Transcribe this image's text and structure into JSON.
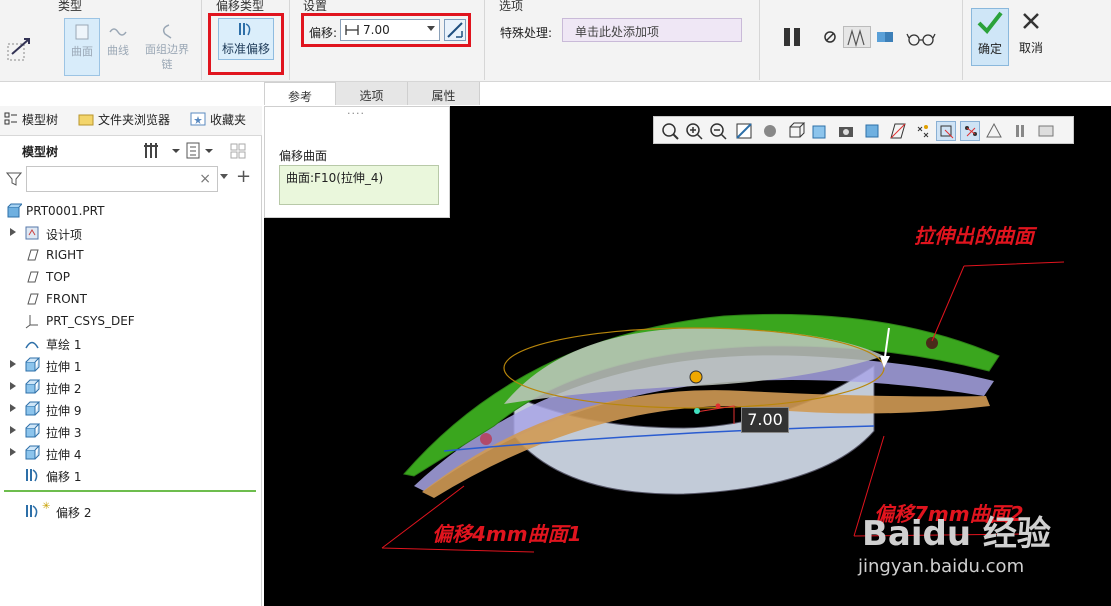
{
  "ribbon": {
    "type_group_title": "类型",
    "type_buttons": [
      {
        "label": "曲面",
        "icon": "surface-icon"
      },
      {
        "label": "曲线",
        "icon": "curve-icon"
      },
      {
        "label": "面组边界链",
        "icon": "quilt-edge-chain-icon"
      }
    ],
    "offset_type_title": "偏移类型",
    "standard_offset_label": "标准偏移",
    "settings_title": "设置",
    "offset_label": "偏移:",
    "offset_value": "7.00",
    "options_title": "选项",
    "special_label": "特殊处理:",
    "special_placeholder": "单击此处添加项",
    "ok_label": "确定",
    "cancel_label": "取消"
  },
  "subtabs": [
    "参考",
    "选项",
    "属性"
  ],
  "left_tabs": [
    "模型树",
    "文件夹浏览器",
    "收藏夹"
  ],
  "tree": {
    "header": "模型树",
    "root": "PRT0001.PRT",
    "items": [
      {
        "label": "设计项",
        "icon": "design-item-icon",
        "expand": true
      },
      {
        "label": "RIGHT",
        "icon": "datum-plane-icon",
        "expand": false
      },
      {
        "label": "TOP",
        "icon": "datum-plane-icon",
        "expand": false
      },
      {
        "label": "FRONT",
        "icon": "datum-plane-icon",
        "expand": false
      },
      {
        "label": "PRT_CSYS_DEF",
        "icon": "csys-icon",
        "expand": false
      },
      {
        "label": "草绘 1",
        "icon": "sketch-icon",
        "expand": false
      },
      {
        "label": "拉伸 1",
        "icon": "extrude-icon",
        "expand": true
      },
      {
        "label": "拉伸 2",
        "icon": "extrude-icon",
        "expand": true
      },
      {
        "label": "拉伸 9",
        "icon": "extrude-icon",
        "expand": true
      },
      {
        "label": "拉伸 3",
        "icon": "extrude-icon",
        "expand": true
      },
      {
        "label": "拉伸 4",
        "icon": "extrude-icon",
        "expand": true
      },
      {
        "label": "偏移 1",
        "icon": "offset-icon",
        "expand": false
      }
    ],
    "insert_item": "偏移 2"
  },
  "references": {
    "label": "偏移曲面",
    "value": "曲面:F10(拉伸_4)"
  },
  "viewport": {
    "dim_value": "7.00",
    "annot_extruded": "拉伸出的曲面",
    "annot_offset1": "偏移4mm曲面1",
    "annot_offset2": "偏移7mm曲面2"
  },
  "watermark": {
    "logo": "Baidu 经验",
    "url": "jingyan.baidu.com"
  },
  "colors": {
    "annotation": "#e0141e",
    "green_surface": "#3aa61e",
    "selection": "#9cc4e4"
  }
}
